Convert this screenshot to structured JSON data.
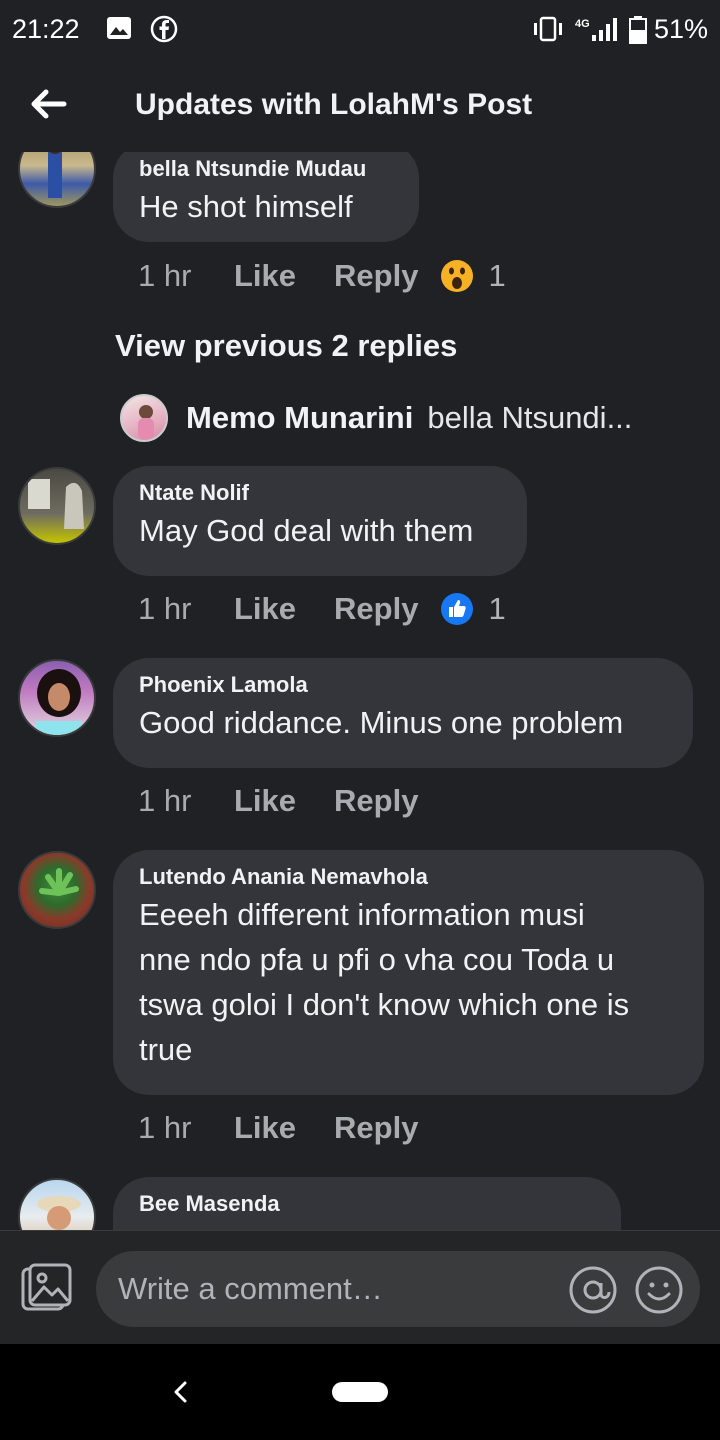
{
  "status_bar": {
    "time": "21:22",
    "network": "4G",
    "battery_pct": "51%",
    "icons": [
      "gallery-icon",
      "facebook-icon",
      "vibrate-icon",
      "signal-icon",
      "battery-icon"
    ]
  },
  "header": {
    "title": "Updates with LolahM's Post",
    "back_icon": "arrow-left-icon"
  },
  "comments": [
    {
      "name": "bella Ntsundie Mudau",
      "text": "He shot  himself",
      "time": "1 hr",
      "like_label": "Like",
      "reply_label": "Reply",
      "reaction": "wow",
      "reaction_count": "1"
    },
    {
      "name": "Ntate Nolif",
      "text": "May God deal with them",
      "time": "1 hr",
      "like_label": "Like",
      "reply_label": "Reply",
      "reaction": "like",
      "reaction_count": "1"
    },
    {
      "name": "Phoenix Lamola",
      "text": "Good riddance. Minus one problem",
      "time": "1 hr",
      "like_label": "Like",
      "reply_label": "Reply"
    },
    {
      "name": "Lutendo Anania Nemavhola",
      "text_lines": [
        "Eeeeh different information musi",
        "nne ndo pfa u pfi o vha cou Toda u",
        "tswa goloi I don't know which one is",
        "true"
      ],
      "time": "1 hr",
      "like_label": "Like",
      "reply_label": "Reply"
    },
    {
      "name": "Bee Masenda"
    }
  ],
  "view_previous": "View previous 2 replies",
  "reply_preview": {
    "name": "Memo Munarini",
    "text": "bella Ntsundi..."
  },
  "composer": {
    "placeholder": "Write a comment…",
    "icons": [
      "photo-icon",
      "mention-icon",
      "emoji-icon"
    ]
  },
  "colors": {
    "background": "#1f2125",
    "bubble": "#33353a",
    "like_blue": "#1877f2",
    "wow_yellow": "#f7b125"
  }
}
